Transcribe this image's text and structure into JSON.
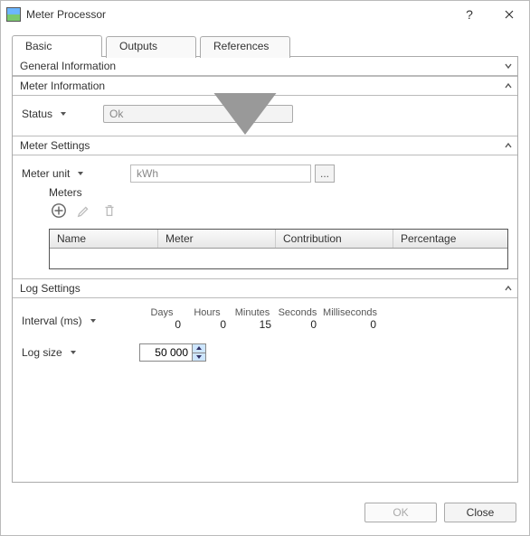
{
  "window": {
    "title": "Meter Processor"
  },
  "tabs": {
    "basic": "Basic",
    "outputs": "Outputs",
    "references": "References"
  },
  "sections": {
    "general": "General Information",
    "meter_info": "Meter Information",
    "meter_settings": "Meter Settings",
    "log_settings": "Log Settings"
  },
  "meter_info": {
    "status_label": "Status",
    "status_value": "Ok"
  },
  "meter_settings": {
    "unit_label": "Meter unit",
    "unit_value": "kWh",
    "ellipsis": "...",
    "meters_label": "Meters",
    "columns": {
      "name": "Name",
      "meter": "Meter",
      "contribution": "Contribution",
      "percentage": "Percentage"
    }
  },
  "log_settings": {
    "interval_label": "Interval (ms)",
    "log_size_label": "Log size",
    "log_size_value": "50 000",
    "labels": {
      "days": "Days",
      "hours": "Hours",
      "minutes": "Minutes",
      "seconds": "Seconds",
      "ms": "Milliseconds"
    },
    "values": {
      "days": "0",
      "hours": "0",
      "minutes": "15",
      "seconds": "0",
      "ms": "0"
    }
  },
  "buttons": {
    "ok": "OK",
    "close": "Close"
  }
}
